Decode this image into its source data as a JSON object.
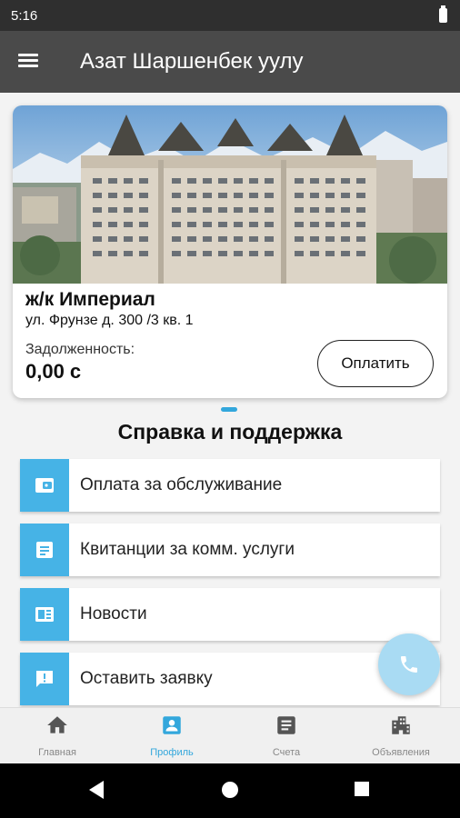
{
  "status_bar": {
    "time": "5:16"
  },
  "app_bar": {
    "title": "Азат Шаршенбек уулу"
  },
  "card": {
    "name": "ж/к Империал",
    "address": "ул. Фрунзе д. 300 /3  кв. 1",
    "debt_label": "Задолженность:",
    "debt_amount": "0,00 с",
    "pay_label": "Оплатить"
  },
  "section": {
    "title": "Справка и поддержка"
  },
  "menu": [
    {
      "label": "Оплата за обслуживание",
      "icon": "wallet-icon"
    },
    {
      "label": "Квитанции за комм. услуги",
      "icon": "document-icon"
    },
    {
      "label": "Новости",
      "icon": "news-icon"
    },
    {
      "label": "Оставить заявку",
      "icon": "feedback-icon"
    }
  ],
  "bottom_nav": [
    {
      "label": "Главная",
      "icon": "home-icon"
    },
    {
      "label": "Профиль",
      "icon": "profile-icon",
      "active": true
    },
    {
      "label": "Счета",
      "icon": "bills-icon"
    },
    {
      "label": "Объявления",
      "icon": "building-icon"
    }
  ],
  "colors": {
    "accent": "#46b3e6",
    "active": "#33a7dc",
    "app_bar": "#4a4a4a"
  }
}
